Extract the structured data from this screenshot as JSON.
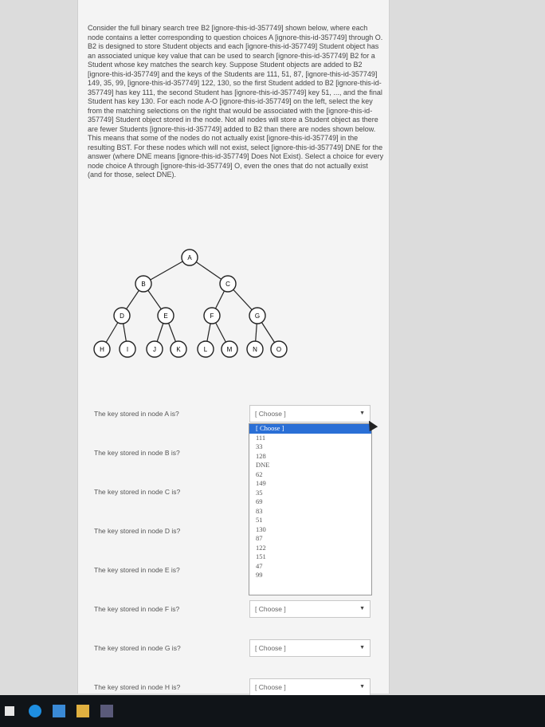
{
  "question": {
    "text": "Consider the full binary search tree B2 [ignore-this-id-357749] shown below, where each node contains a letter corresponding to question choices A [ignore-this-id-357749] through O. B2 is designed to store Student objects and each [ignore-this-id-357749] Student object has an associated unique key value that can be used to search [ignore-this-id-357749] B2 for a Student whose key matches the search key. Suppose Student objects are added to B2 [ignore-this-id-357749] and the keys of the Students are 111, 51, 87, [ignore-this-id-357749] 149, 35, 99, [ignore-this-id-357749] 122, 130, so the first Student added to B2 [ignore-this-id-357749] has key 111, the second Student has [ignore-this-id-357749] key 51, ..., and the final Student has key 130. For each node A-O [ignore-this-id-357749] on the left, select the key from the matching selections on the right that would be associated with the [ignore-this-id-357749] Student object stored in the node. Not all nodes will store a Student object as there are fewer Students [ignore-this-id-357749] added to B2 than there are nodes shown below. This means that some of the nodes do not actually exist [ignore-this-id-357749] in the resulting BST. For these nodes which will not exist, select [ignore-this-id-357749] DNE for the answer (where DNE means [ignore-this-id-357749] Does Not Exist). Select a choice for every node choice A through [ignore-this-id-357749] O, even the ones that do not actually exist (and for those, select DNE)."
  },
  "tree": {
    "nodes": [
      "A",
      "B",
      "C",
      "D",
      "E",
      "F",
      "G",
      "H",
      "I",
      "J",
      "K",
      "L",
      "M",
      "N",
      "O"
    ]
  },
  "rows": [
    {
      "label": "The key stored in node A is?",
      "value": "[ Choose ]"
    },
    {
      "label": "The key stored in node B is?",
      "value": "[ Choose ]"
    },
    {
      "label": "The key stored in node C is?",
      "value": "[ Choose ]"
    },
    {
      "label": "The key stored in node D is?",
      "value": "[ Choose ]"
    },
    {
      "label": "The key stored in node E is?",
      "value": "[ Choose ]"
    },
    {
      "label": "The key stored in node F is?",
      "value": "[ Choose ]"
    },
    {
      "label": "The key stored in node G is?",
      "value": "[ Choose ]"
    },
    {
      "label": "The key stored in node H is?",
      "value": "[ Choose ]"
    }
  ],
  "dropdown": {
    "options": [
      "[ Choose ]",
      "111",
      "33",
      "128",
      "DNE",
      "62",
      "149",
      "35",
      "69",
      "83",
      "51",
      "130",
      "87",
      "122",
      "151",
      "47",
      "99"
    ],
    "selected_index": 0
  },
  "colors": {
    "accent": "#2a6fd6",
    "taskbar": "#101418"
  }
}
